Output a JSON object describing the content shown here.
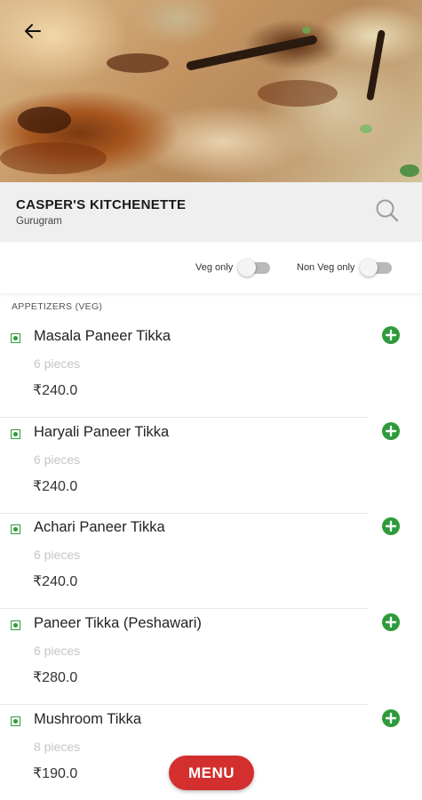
{
  "restaurant": {
    "name": "CASPER'S KITCHENETTE",
    "city": "Gurugram"
  },
  "filters": [
    {
      "label": "Veg only",
      "enabled": false
    },
    {
      "label": "Non Veg only",
      "enabled": false
    }
  ],
  "section": {
    "title": "APPETIZERS (VEG)"
  },
  "items": [
    {
      "name": "Masala Paneer Tikka",
      "desc": "6 pieces",
      "price": "₹240.0"
    },
    {
      "name": "Haryali Paneer Tikka",
      "desc": "6 pieces",
      "price": "₹240.0"
    },
    {
      "name": "Achari Paneer Tikka",
      "desc": "6 pieces",
      "price": "₹240.0"
    },
    {
      "name": "Paneer Tikka (Peshawari)",
      "desc": "6 pieces",
      "price": "₹280.0"
    },
    {
      "name": "Mushroom Tikka",
      "desc": "8 pieces",
      "price": "₹190.0"
    }
  ],
  "menu_button": {
    "label": "MENU"
  },
  "icons": {
    "back": "back-arrow-icon",
    "search": "search-icon",
    "add": "add-circle-icon",
    "veg": "veg-indicator-icon"
  },
  "colors": {
    "accent_green": "#2e9b3a",
    "menu_red": "#d32f2f",
    "header_bg": "#efefef"
  }
}
